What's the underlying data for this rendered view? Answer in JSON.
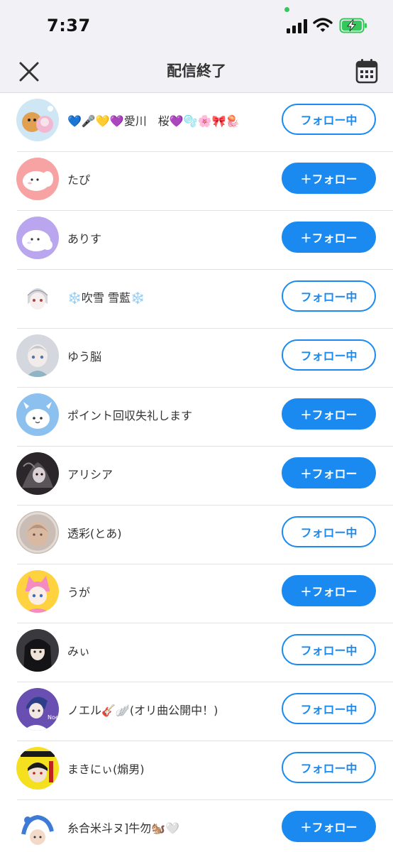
{
  "status_bar": {
    "time": "7:37",
    "icons": [
      "signal-icon",
      "wifi-icon",
      "battery-charging-icon"
    ]
  },
  "nav": {
    "title": "配信終了",
    "left_icon": "close-icon",
    "right_icon": "calendar-icon"
  },
  "colors": {
    "accent": "#1a8af0",
    "privacy_dot": "#34c759",
    "battery": "#34c759"
  },
  "users": [
    {
      "name": "💙🎤💛💜愛川　桜💜🫧🌸🎀🪼",
      "button": "フォロー中",
      "following": true
    },
    {
      "name": "たぴ",
      "button": "＋フォロー",
      "following": false
    },
    {
      "name": "ありす",
      "button": "＋フォロー",
      "following": false
    },
    {
      "name": "❄️吹雪 雪藍❄️",
      "button": "フォロー中",
      "following": true
    },
    {
      "name": "ゆう脳",
      "button": "フォロー中",
      "following": true
    },
    {
      "name": "ポイント回収失礼します",
      "button": "＋フォロー",
      "following": false
    },
    {
      "name": "アリシア",
      "button": "＋フォロー",
      "following": false
    },
    {
      "name": "透彩(とあ)",
      "button": "フォロー中",
      "following": true
    },
    {
      "name": "うが",
      "button": "＋フォロー",
      "following": false
    },
    {
      "name": "みぃ",
      "button": "フォロー中",
      "following": true
    },
    {
      "name": "ノエル🎸🪽(オリ曲公開中！)",
      "button": "フォロー中",
      "following": true
    },
    {
      "name": "まきにぃ(煽男)",
      "button": "フォロー中",
      "following": true
    },
    {
      "name": "糸合米斗ヌ]牛勿🐿️🤍",
      "button": "＋フォロー",
      "following": false
    }
  ]
}
